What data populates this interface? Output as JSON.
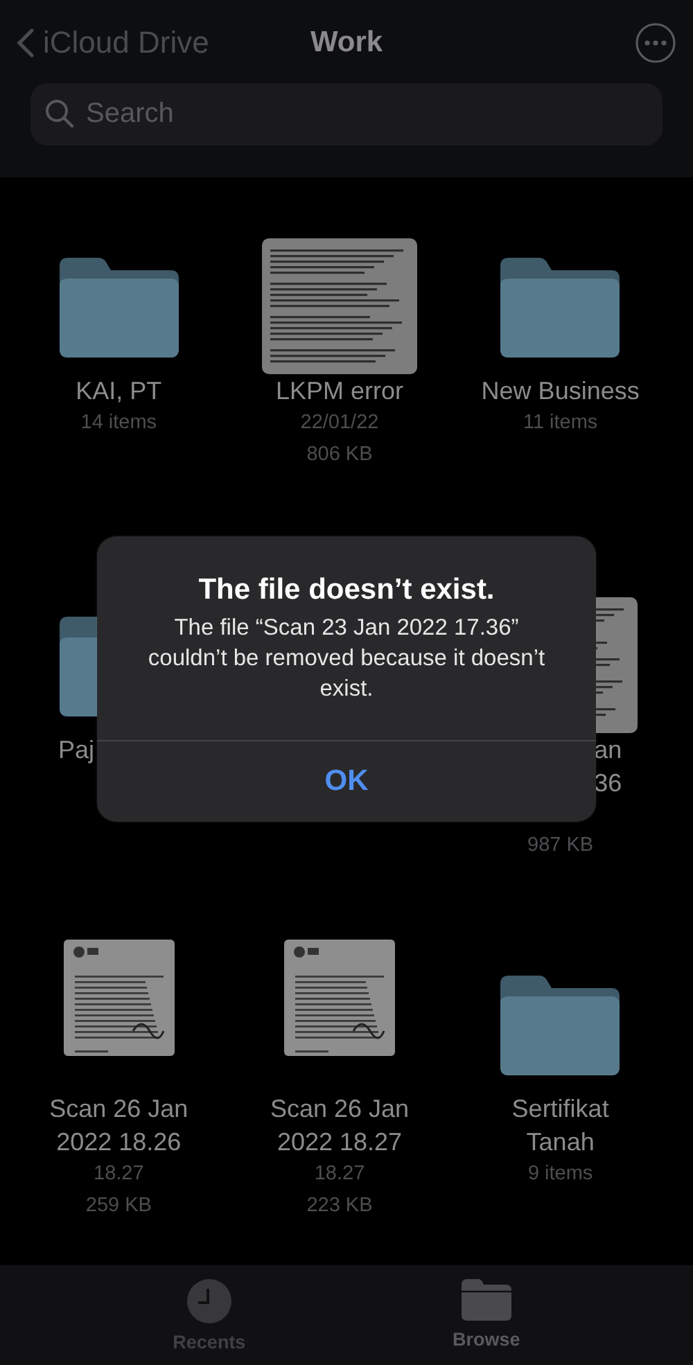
{
  "nav": {
    "back": "iCloud Drive",
    "title": "Work"
  },
  "search": {
    "placeholder": "Search"
  },
  "rows": [
    {
      "items": [
        {
          "kind": "folder",
          "name_lines": [
            "KAI, PT"
          ],
          "details": [
            "14 items"
          ]
        },
        {
          "kind": "document",
          "name_lines": [
            "LKPM error"
          ],
          "details": [
            "22/01/22",
            "806 KB"
          ]
        },
        {
          "kind": "folder",
          "name_lines": [
            "New Business"
          ],
          "details": [
            "11 items"
          ]
        }
      ]
    },
    {
      "items": [
        {
          "kind": "folder",
          "name_lines": [
            "Paj"
          ]
        },
        {
          "kind": "hidden"
        },
        {
          "kind": "document",
          "name_lines": [
            "an",
            "36"
          ],
          "details": [
            "987 KB"
          ]
        }
      ]
    },
    {
      "items": [
        {
          "kind": "scan",
          "name_lines": [
            "Scan 26 Jan",
            "2022 18.26"
          ],
          "details": [
            "18.27",
            "259 KB"
          ]
        },
        {
          "kind": "scan",
          "name_lines": [
            "Scan 26 Jan",
            "2022 18.27"
          ],
          "details": [
            "18.27",
            "223 KB"
          ]
        },
        {
          "kind": "folder",
          "name_lines": [
            "Sertifikat",
            "Tanah"
          ],
          "details": [
            "9 items"
          ]
        }
      ]
    }
  ],
  "alert": {
    "title": "The file doesn’t exist.",
    "message": "The file “Scan 23 Jan 2022 17.36” couldn’t be removed because it doesn’t exist.",
    "button": "OK"
  },
  "tabs": [
    {
      "kind": "recents",
      "label": "Recents",
      "selected": false
    },
    {
      "kind": "browse",
      "label": "Browse",
      "selected": true
    }
  ]
}
